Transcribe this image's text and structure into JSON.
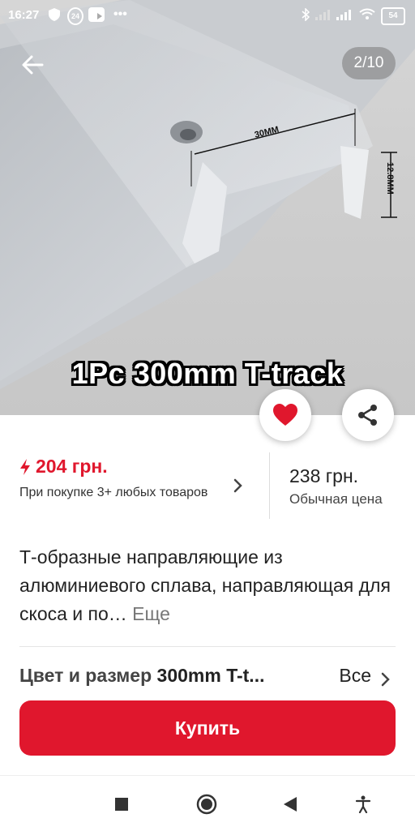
{
  "status_bar": {
    "time": "16:27",
    "notification_badge": "24",
    "battery": "54"
  },
  "gallery": {
    "counter": "2/10",
    "caption": "1Pc 300mm T-track",
    "dim_width": "30MM",
    "dim_height": "12.8MM"
  },
  "price": {
    "sale": "204 грн.",
    "sale_condition": "При покупке 3+ любых товаров",
    "regular": "238 грн.",
    "regular_label": "Обычная цена"
  },
  "description": {
    "text": "Т-образные направляющие из алюминиевого сплава, направляющая для скоса и по…",
    "more_label": "Еще"
  },
  "variant": {
    "label": "Цвет и размер",
    "value": "300mm T-t...",
    "all_label": "Все"
  },
  "buy_button": {
    "label": "Купить"
  },
  "colors": {
    "accent": "#e0172d"
  },
  "icons": [
    "arrow-left-icon",
    "heart-icon",
    "share-icon",
    "lightning-icon",
    "chevron-right-icon",
    "stop-icon",
    "home-icon",
    "back-triangle-icon",
    "accessibility-icon"
  ]
}
